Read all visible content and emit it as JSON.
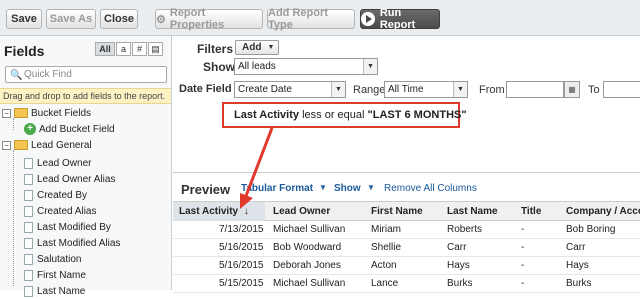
{
  "toolbar": {
    "save": "Save",
    "save_as": "Save As",
    "close": "Close",
    "report_properties": "Report Properties",
    "add_report_type": "Add Report Type",
    "run_report": "Run Report"
  },
  "fields_panel": {
    "title": "Fields",
    "filter_tabs": [
      "All",
      "a",
      "#",
      "▤"
    ],
    "quick_find_placeholder": "Quick Find",
    "hint": "Drag and drop to add fields to the report.",
    "tree": [
      {
        "label": "Bucket Fields",
        "type": "folder"
      },
      {
        "label": "Add Bucket Field",
        "type": "add"
      },
      {
        "label": "Lead General",
        "type": "folder"
      },
      {
        "label": "Lead Owner",
        "type": "field"
      },
      {
        "label": "Lead Owner Alias",
        "type": "field"
      },
      {
        "label": "Created By",
        "type": "field"
      },
      {
        "label": "Created Alias",
        "type": "field"
      },
      {
        "label": "Last Modified By",
        "type": "field"
      },
      {
        "label": "Last Modified Alias",
        "type": "field"
      },
      {
        "label": "Salutation",
        "type": "field"
      },
      {
        "label": "First Name",
        "type": "field"
      },
      {
        "label": "Last Name",
        "type": "field"
      }
    ]
  },
  "filters": {
    "label": "Filters",
    "add_label": "Add",
    "show_label": "Show",
    "show_value": "All leads",
    "date_field_label": "Date Field",
    "date_field_value": "Create Date",
    "range_label": "Range",
    "range_value": "All Time",
    "from_label": "From",
    "to_label": "To",
    "active_filter": {
      "field": "Last Activity",
      "operator": "less or equal",
      "value": "\"LAST 6 MONTHS\""
    }
  },
  "preview": {
    "title": "Preview",
    "format_label": "Tabular Format",
    "show_label": "Show",
    "remove_all_label": "Remove All Columns",
    "columns": [
      "Last Activity",
      "Lead Owner",
      "First Name",
      "Last Name",
      "Title",
      "Company / Accou"
    ],
    "sort_indicator": "↓",
    "rows": [
      [
        "7/13/2015",
        "Michael Sullivan",
        "Miriam",
        "Roberts",
        "-",
        "Bob Boring"
      ],
      [
        "5/16/2015",
        "Bob Woodward",
        "Shellie",
        "Carr",
        "-",
        "Carr"
      ],
      [
        "5/16/2015",
        "Deborah Jones",
        "Acton",
        "Hays",
        "-",
        "Hays"
      ],
      [
        "5/15/2015",
        "Michael Sullivan",
        "Lance",
        "Burks",
        "-",
        "Burks"
      ]
    ]
  },
  "colors": {
    "accent_red": "#e0392b",
    "link_blue": "#1a5a9a"
  }
}
